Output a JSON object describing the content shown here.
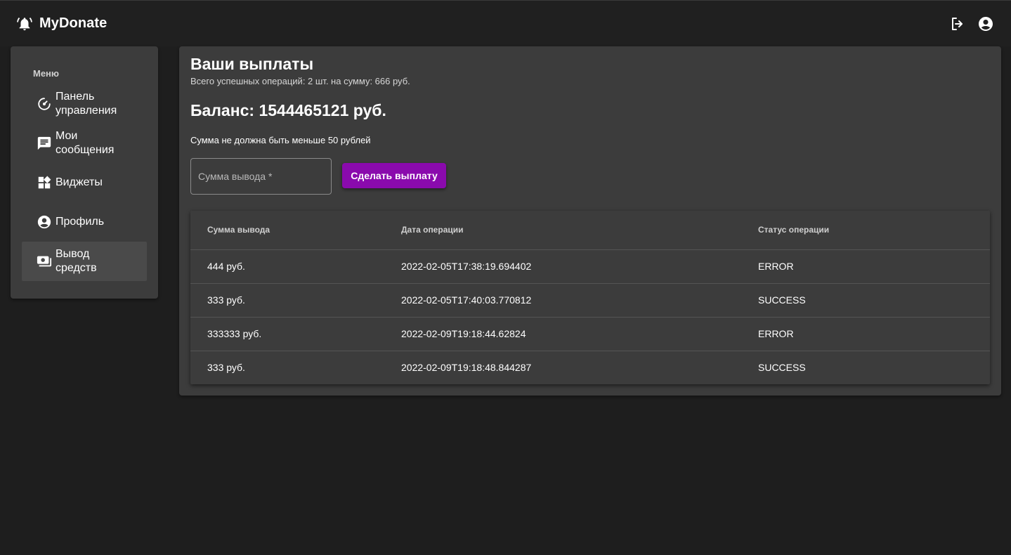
{
  "app": {
    "title": "MyDonate",
    "brand_icon": "bell-icon",
    "actions": [
      {
        "name": "logout-icon"
      },
      {
        "name": "account-circle-icon"
      }
    ]
  },
  "sidebar": {
    "title": "Меню",
    "items": [
      {
        "label": "Панель управления",
        "icon": "speedometer-icon",
        "active": false
      },
      {
        "label": "Мои сообщения",
        "icon": "message-icon",
        "active": false
      },
      {
        "label": "Виджеты",
        "icon": "widgets-icon",
        "active": false
      },
      {
        "label": "Профиль",
        "icon": "account-circle-icon",
        "active": false
      },
      {
        "label": "Вывод средств",
        "icon": "payments-icon",
        "active": true
      }
    ]
  },
  "main": {
    "title": "Ваши выплаты",
    "summary": "Всего успешных операций: 2 шт. на сумму: 666 руб.",
    "balance": "Баланс: 1544465121 руб.",
    "min_note": "Сумма не должна быть меньше 50 рублей",
    "amount_field": {
      "placeholder": "Сумма вывода *",
      "value": ""
    },
    "payout_button": "Сделать выплату",
    "table": {
      "headers": [
        "Сумма вывода",
        "Дата операции",
        "Статус операции"
      ],
      "rows": [
        [
          "444 руб.",
          "2022-02-05T17:38:19.694402",
          "ERROR"
        ],
        [
          "333 руб.",
          "2022-02-05T17:40:03.770812",
          "SUCCESS"
        ],
        [
          "333333 руб.",
          "2022-02-09T19:18:44.62824",
          "ERROR"
        ],
        [
          "333 руб.",
          "2022-02-09T19:18:48.844287",
          "SUCCESS"
        ]
      ]
    }
  },
  "colors": {
    "background": "#1e1e1e",
    "appbar": "#202020",
    "panel": "#3c3c3c",
    "accent": "#8a0aad",
    "text": "#ffffff"
  }
}
